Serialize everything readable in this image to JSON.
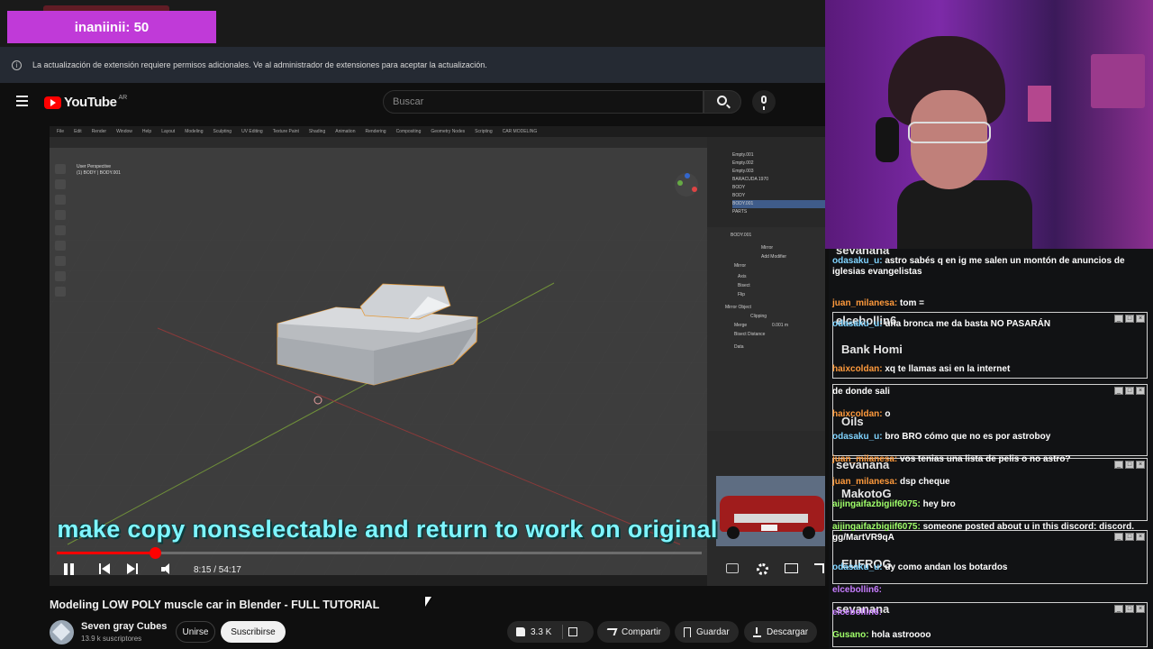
{
  "overlay": {
    "counter_text": "inaniinii: 50"
  },
  "extension_bar": {
    "message": "La actualización de extensión requiere permisos adicionales. Ve al administrador de extensiones para aceptar la actualización."
  },
  "youtube": {
    "logo_text": "YouTube",
    "country_code": "AR",
    "search_placeholder": "Buscar"
  },
  "video": {
    "subtitle": "make copy nonselectable and return to work on original",
    "time": "8:15 / 54:17",
    "progress_fraction": 0.152,
    "blender": {
      "menu": [
        "File",
        "Edit",
        "Render",
        "Window",
        "Help",
        "Layout",
        "Modeling",
        "Sculpting",
        "UV Editing",
        "Texture Paint",
        "Shading",
        "Animation",
        "Rendering",
        "Compositing",
        "Geometry Nodes",
        "Scripting",
        "CAR MODELING"
      ],
      "viewport_info": [
        "User Perspective",
        "(1) BODY | BODY.001"
      ],
      "outliner": [
        "Empty.001",
        "Empty.002",
        "Empty.003",
        "BARACUDA 1970",
        "BODY",
        "BODY",
        "BODY.001",
        "PARTS"
      ],
      "modifier_panel": [
        "BODY.001",
        "Mirror",
        "Add Modifier",
        "Mirror",
        "Axis",
        "Bisect",
        "Flip",
        "Mirror Object",
        "Clipping",
        "Merge",
        "0.001 m",
        "Bisect Distance",
        "Data"
      ]
    }
  },
  "video_meta": {
    "title": "Modeling LOW POLY muscle car in Blender - FULL TUTORIAL",
    "channel": "Seven gray Cubes",
    "subscribers": "13.9 k suscriptores",
    "join_label": "Unirse",
    "subscribe_label": "Suscribirse",
    "likes": "3.3 K",
    "share_label": "Compartir",
    "save_label": "Guardar",
    "download_label": "Descargar"
  },
  "chat": {
    "overlay_names": [
      "sevanana",
      "elcebollin6",
      "Bank Homi",
      "Oils",
      "sevanana",
      "MakotoG",
      "EUFROG",
      "sevanana"
    ],
    "messages": [
      {
        "user": "odasaku_u:",
        "text": "astro sabés q en ig me salen un montón de anuncios de iglesias evangelistas",
        "color": "#7fd3ff"
      },
      {
        "user": "juan_milanesa:",
        "text": "tom =",
        "color": "#ff9a3c"
      },
      {
        "user": "odasaku_u:",
        "text": "una bronca me da basta NO PASARÁN",
        "color": "#7fd3ff"
      },
      {
        "user": "haixcoldan:",
        "text": "xq te llamas asi en la internet",
        "color": "#ff9a3c"
      },
      {
        "user": "",
        "text": "de donde sali",
        "color": "#ff9a3c"
      },
      {
        "user": "haixcoldan:",
        "text": "o",
        "color": "#ff9a3c"
      },
      {
        "user": "odasaku_u:",
        "text": "bro BRO cómo que no es por astroboy",
        "color": "#7fd3ff"
      },
      {
        "user": "juan_milanesa:",
        "text": "vos tenias una lista de pelis o no astro?",
        "color": "#ff9a3c"
      },
      {
        "user": "juan_milanesa:",
        "text": "dsp cheque",
        "color": "#ff9a3c"
      },
      {
        "user": "aijingaifazbigiif6075:",
        "text": "hey bro",
        "color": "#a0ff6a"
      },
      {
        "user": "aijingaifazbigiif6075:",
        "text": "someone posted about u in this discord: discord. gg/MartVR9qA",
        "color": "#a0ff6a"
      },
      {
        "user": "odasaku_u:",
        "text": "uy como andan los botardos",
        "color": "#7fd3ff"
      },
      {
        "user": "elcebollin6:",
        "text": "",
        "color": "#c77dff"
      },
      {
        "user": "elcebollin6:",
        "text": "",
        "color": "#c77dff"
      },
      {
        "user": "Gusano:",
        "text": "hola astroooo",
        "color": "#a0ff6a"
      }
    ]
  },
  "colors": {
    "youtube_red": "#ff0000",
    "subtitle_cyan": "#7ff5ff",
    "overlay_purple": "#c03ad8"
  },
  "icons": [
    "info-icon",
    "hamburger-menu-icon",
    "search-icon",
    "microphone-icon",
    "play-pause-icon",
    "previous-icon",
    "next-icon",
    "volume-icon",
    "captions-icon",
    "settings-gear-icon",
    "miniplayer-icon",
    "fullscreen-icon",
    "thumbs-up-icon",
    "thumbs-down-icon",
    "share-icon",
    "bookmark-icon",
    "download-icon"
  ]
}
